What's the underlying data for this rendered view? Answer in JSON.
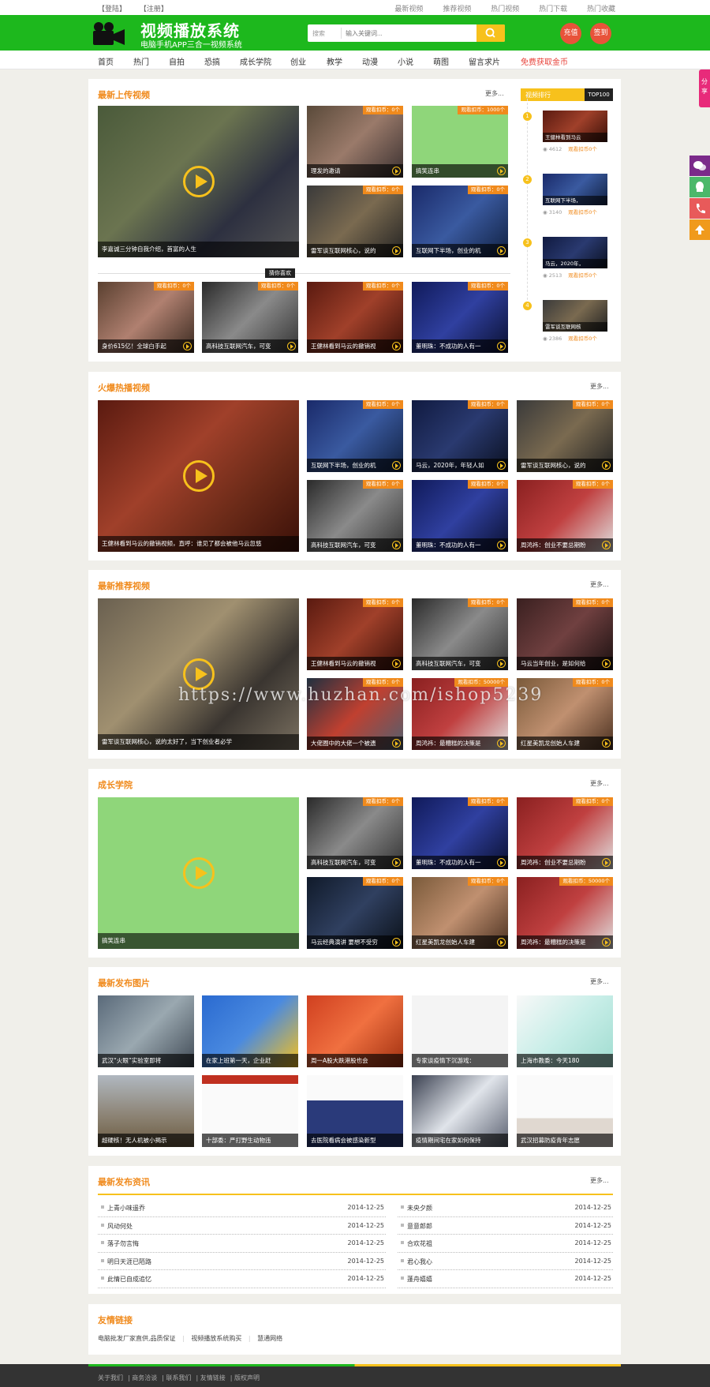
{
  "topbar": {
    "login": "【登陆】",
    "register": "【注册】",
    "links": [
      "最新视频",
      "推荐视频",
      "热门视频",
      "热门下载",
      "热门收藏"
    ]
  },
  "header": {
    "title": "视频播放系统",
    "subtitle": "电脑手机APP三合一视频系统",
    "search_cat": "搜索",
    "search_placeholder": "输入关键词...",
    "btn1": "充值",
    "btn2": "签到"
  },
  "nav": [
    "首页",
    "热门",
    "自拍",
    "恐搞",
    "成长学院",
    "创业",
    "教学",
    "动漫",
    "小说",
    "萌图",
    "留言求片",
    "免费获取金币"
  ],
  "more": "更多...",
  "s1": {
    "title": "最新上传视频",
    "main": "李嘉诚三分钟自我介绍，首富的人生",
    "grid": [
      {
        "cap": "理发的邀请",
        "tag": "观看扣币：0个"
      },
      {
        "cap": "搞笑连串",
        "tag": "观看扣币：1000个"
      },
      {
        "cap": "雷军谈互联网核心，说的",
        "tag": "观看扣币：0个"
      },
      {
        "cap": "互联网下半场，创业的机",
        "tag": "观看扣币：0个"
      }
    ],
    "guess": "猜你喜欢",
    "bottom": [
      {
        "cap": "身价615亿！全球白手起",
        "tag": "观看扣币：0个"
      },
      {
        "cap": "高科技互联网汽车，可变",
        "tag": "观看扣币：0个"
      },
      {
        "cap": "王健林看到马云的撤销视",
        "tag": "观看扣币：0个"
      },
      {
        "cap": "董明珠：不成功的人有一",
        "tag": "观看扣币：0个"
      }
    ],
    "rank_title": "视频排行",
    "rank_badge": "TOP100",
    "rank": [
      {
        "n": "1",
        "cap": "王健林看到马云",
        "views": "4612",
        "cost": "观看扣币0个"
      },
      {
        "n": "2",
        "cap": "互联网下半场，",
        "views": "3140",
        "cost": "观看扣币0个"
      },
      {
        "n": "3",
        "cap": "马云，2020年，",
        "views": "2513",
        "cost": "观看扣币0个"
      },
      {
        "n": "4",
        "cap": "雷军谈互联网核",
        "views": "2386",
        "cost": "观看扣币0个"
      }
    ]
  },
  "s2": {
    "title": "火爆热播视频",
    "main": "王健林看到马云的撤销视频，直呼：谁见了都会被他马云忽悠",
    "grid": [
      {
        "cap": "互联网下半场，创业的机",
        "tag": "观看扣币：0个"
      },
      {
        "cap": "马云，2020年，年轻人如",
        "tag": "观看扣币：0个"
      },
      {
        "cap": "雷军谈互联网核心，说的",
        "tag": "观看扣币：0个"
      },
      {
        "cap": "高科技互联网汽车，可变",
        "tag": "观看扣币：0个"
      },
      {
        "cap": "董明珠：不成功的人有一",
        "tag": "观看扣币：0个"
      },
      {
        "cap": "周鸿祎：创业不要总期盼",
        "tag": "观看扣币：0个"
      }
    ]
  },
  "s3": {
    "title": "最新推荐视频",
    "main": "雷军谈互联网核心，说的太好了，当下创业者必学",
    "grid": [
      {
        "cap": "王健林看到马云的撤销视",
        "tag": "观看扣币：0个"
      },
      {
        "cap": "高科技互联网汽车，可变",
        "tag": "观看扣币：0个"
      },
      {
        "cap": "马云当年创业，是如何给",
        "tag": "观看扣币：0个"
      },
      {
        "cap": "大佬圈中的大佬一个被遗",
        "tag": "观看扣币：0个"
      },
      {
        "cap": "周鸿祎：最糟糕的决策是",
        "tag": "观看扣币：50000个"
      },
      {
        "cap": "红星美凯龙创始人车建",
        "tag": "观看扣币：0个"
      }
    ]
  },
  "s4": {
    "title": "成长学院",
    "main": "搞笑连串",
    "grid": [
      {
        "cap": "高科技互联网汽车，可变",
        "tag": "观看扣币：0个"
      },
      {
        "cap": "董明珠：不成功的人有一",
        "tag": "观看扣币：0个"
      },
      {
        "cap": "周鸿祎：创业不要总期盼",
        "tag": "观看扣币：0个"
      },
      {
        "cap": "马云经典演讲 要想不受穷",
        "tag": "观看扣币：0个"
      },
      {
        "cap": "红星美凯龙创始人车建",
        "tag": "观看扣币：0个"
      },
      {
        "cap": "周鸿祎：最糟糕的决策是",
        "tag": "观看扣币：50000个"
      }
    ]
  },
  "s5": {
    "title": "最新发布图片",
    "items": [
      "武汉“火眼”实验室即将",
      "在家上班第一天，企业赶",
      "周一A股大跌港股也会",
      "专家谈疫情下沉游戏：",
      "上海市教委：今天180",
      "超硬核！无人机被小揭示",
      "十部委：严打野生动物违",
      "去医院看病会被感染新型",
      "疫情期间宅在家如何保持",
      "武汉招募防疫青年志愿"
    ]
  },
  "s6": {
    "title": "最新发布资讯",
    "left": [
      {
        "t": "上青小味遥乔",
        "d": "2014-12-25"
      },
      {
        "t": "风动何处",
        "d": "2014-12-25"
      },
      {
        "t": "落子勿言悔",
        "d": "2014-12-25"
      },
      {
        "t": "明日天涯已陌路",
        "d": "2014-12-25"
      },
      {
        "t": "此情已自成追忆",
        "d": "2014-12-25"
      }
    ],
    "right": [
      {
        "t": "未央夕颜",
        "d": "2014-12-25"
      },
      {
        "t": "意意郎郎",
        "d": "2014-12-25"
      },
      {
        "t": "合欢花祖",
        "d": "2014-12-25"
      },
      {
        "t": "君心我心",
        "d": "2014-12-25"
      },
      {
        "t": "蓬舟嬉嬉",
        "d": "2014-12-25"
      }
    ]
  },
  "friends": {
    "title": "友情链接",
    "links": [
      "电脑批发厂家直供,品质保证",
      "视频播放系统购买",
      "慧通网络"
    ]
  },
  "footer": [
    "关于我们",
    "商务洽谈",
    "联系我们",
    "友情链接",
    "版权声明"
  ],
  "share": "分享",
  "watermark": "https://www.huzhan.com/ishop5239",
  "colors": {
    "green": "#1db81d",
    "orange": "#f08a1c",
    "yellow": "#f7c11c",
    "red": "#e8533a"
  }
}
